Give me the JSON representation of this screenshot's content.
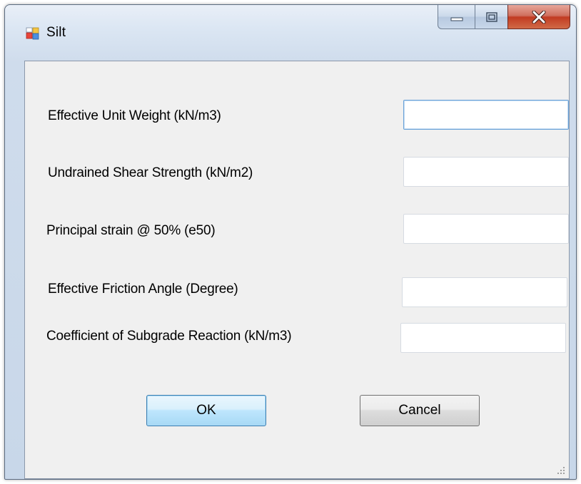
{
  "window": {
    "title": "Silt",
    "icon": "app-icon"
  },
  "form": {
    "fields": [
      {
        "label": "Effective Unit Weight (kN/m3)",
        "value": "",
        "focused": true
      },
      {
        "label": "Undrained Shear Strength (kN/m2)",
        "value": ""
      },
      {
        "label": "Principal strain @ 50% (e50)",
        "value": ""
      },
      {
        "label": "Effective Friction Angle (Degree)",
        "value": ""
      },
      {
        "label": "Coefficient of Subgrade Reaction (kN/m3)",
        "value": ""
      }
    ]
  },
  "buttons": {
    "ok_label": "OK",
    "cancel_label": "Cancel"
  },
  "colors": {
    "close_button": "#c23b22",
    "default_button_border": "#3c7fb1",
    "client_background": "#f0f0f0"
  }
}
